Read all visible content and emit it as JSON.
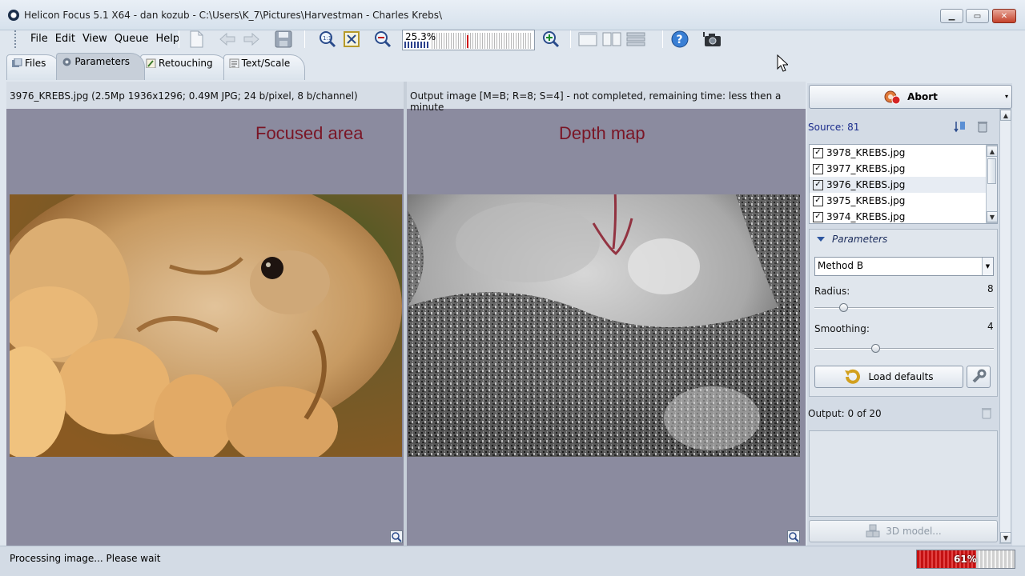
{
  "window": {
    "title": "Helicon Focus 5.1 X64 - dan kozub - C:\\Users\\K_7\\Pictures\\Harvestman - Charles Krebs\\",
    "min_glyph": "▁",
    "max_glyph": "▭",
    "close_glyph": "✕"
  },
  "menu": [
    "File",
    "Edit",
    "View",
    "Queue",
    "Help"
  ],
  "toolbar": {
    "zoom_value": "25.3%"
  },
  "tabs": [
    "Files",
    "Parameters",
    "Retouching",
    "Text/Scale"
  ],
  "active_tab": "Parameters",
  "left_panel": {
    "header": "3976_KREBS.jpg (2.5Mp 1936x1296; 0.49M JPG; 24 b/pixel, 8 b/channel)",
    "annotation": "Focused area"
  },
  "right_image_panel": {
    "header": "Output image [M=B; R=8; S=4] - not completed, remaining time: less then a minute",
    "annotation": "Depth map"
  },
  "side": {
    "abort_label": "Abort",
    "source_label": "Source: 81",
    "files": [
      {
        "name": "3978_KREBS.jpg",
        "checked": true
      },
      {
        "name": "3977_KREBS.jpg",
        "checked": true
      },
      {
        "name": "3976_KREBS.jpg",
        "checked": true
      },
      {
        "name": "3975_KREBS.jpg",
        "checked": true
      },
      {
        "name": "3974_KREBS.jpg",
        "checked": true
      }
    ],
    "selected_file": "3976_KREBS.jpg",
    "parameters_title": "Parameters",
    "method": "Method B",
    "radius_label": "Radius:",
    "radius_value": "8",
    "smoothing_label": "Smoothing:",
    "smoothing_value": "4",
    "load_defaults_label": "Load defaults",
    "output_label": "Output: 0 of 20",
    "model_label": "3D model..."
  },
  "status": {
    "text": "Processing image... Please wait",
    "progress": 61,
    "progress_label": "61%"
  }
}
